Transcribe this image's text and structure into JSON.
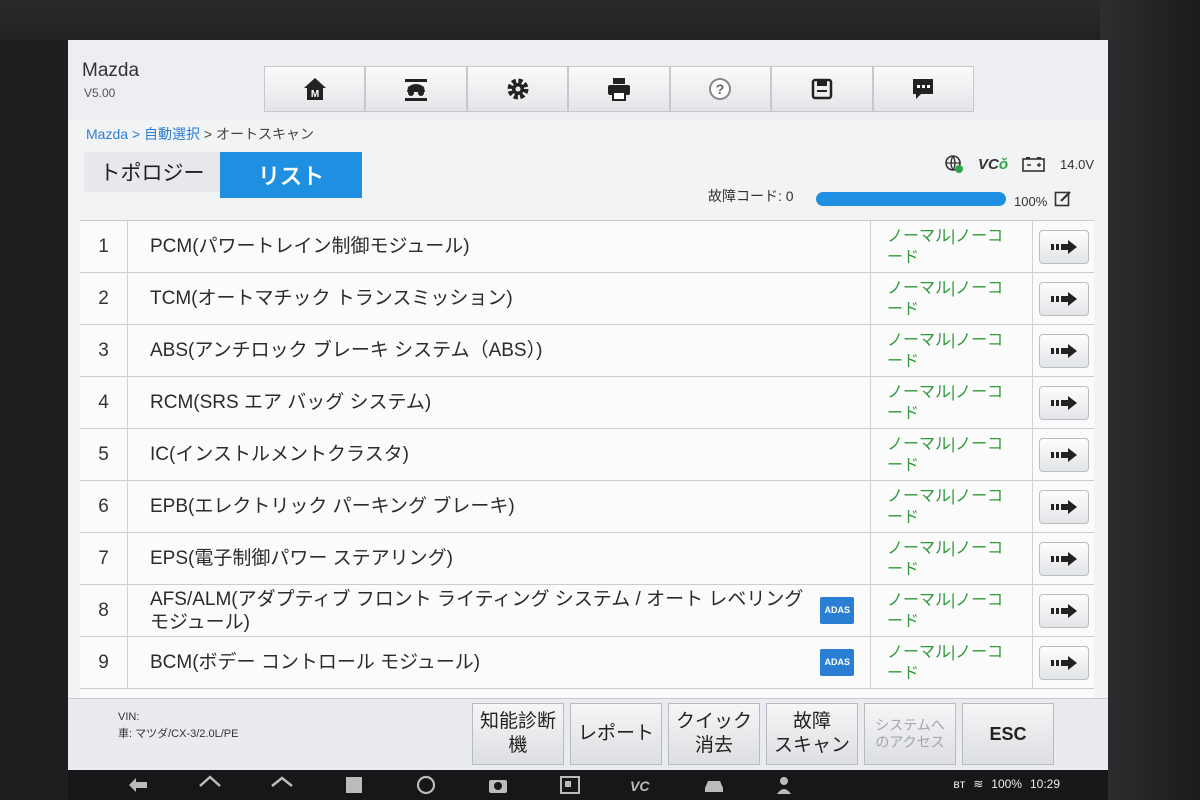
{
  "header": {
    "app_title": "Mazda",
    "version": "V5.00"
  },
  "toolbar": [
    {
      "icon": "home-m-icon"
    },
    {
      "icon": "vehicle-lift-icon"
    },
    {
      "icon": "gear-icon"
    },
    {
      "icon": "printer-icon"
    },
    {
      "icon": "help-icon"
    },
    {
      "icon": "save-icon"
    },
    {
      "icon": "message-icon"
    }
  ],
  "breadcrumb": {
    "part1": "Mazda",
    "sep1": " > ",
    "part2": "自動選択",
    "sep2": " > ",
    "current": "オートスキャン"
  },
  "tabs": {
    "topology": "トポロジー",
    "list": "リスト"
  },
  "status_bar": {
    "vci": "VC",
    "battery": "14.0V"
  },
  "dtc": {
    "label": "故障コード: 0",
    "progress_percent": 100,
    "progress_text": "100%"
  },
  "rows": [
    {
      "num": "1",
      "name": "PCM(パワートレイン制御モジュール)",
      "adas": "",
      "status": "ノーマル|ノーコード"
    },
    {
      "num": "2",
      "name": "TCM(オートマチック トランスミッション)",
      "adas": "",
      "status": "ノーマル|ノーコード"
    },
    {
      "num": "3",
      "name": "ABS(アンチロック ブレーキ システム（ABS）)",
      "adas": "",
      "status": "ノーマル|ノーコード"
    },
    {
      "num": "4",
      "name": "RCM(SRS エア バッグ システム)",
      "adas": "",
      "status": "ノーマル|ノーコード"
    },
    {
      "num": "5",
      "name": "IC(インストルメントクラスタ)",
      "adas": "",
      "status": "ノーマル|ノーコード"
    },
    {
      "num": "6",
      "name": "EPB(エレクトリック パーキング ブレーキ)",
      "adas": "",
      "status": "ノーマル|ノーコード"
    },
    {
      "num": "7",
      "name": "EPS(電子制御パワー ステアリング)",
      "adas": "",
      "status": "ノーマル|ノーコード"
    },
    {
      "num": "8",
      "name": "AFS/ALM(アダプティブ フロント ライティング システム / オート レベリング モジュール)",
      "adas": "ADAS",
      "status": "ノーマル|ノーコード"
    },
    {
      "num": "9",
      "name": "BCM(ボデー コントロール モジュール)",
      "adas": "ADAS",
      "status": "ノーマル|ノーコード"
    }
  ],
  "footer": {
    "vin": "VIN:",
    "car": "車: マツダ/CX-3/2.0L/PE",
    "buttons": {
      "intelligent": "知能診断機",
      "report": "レポート",
      "quick_clear": "クイック\n消去",
      "fault_scan": "故障\nスキャン",
      "system_access": "システムへ\nのアクセス",
      "esc": "ESC"
    }
  },
  "system_tray": {
    "battery": "100%",
    "time": "10:29"
  }
}
